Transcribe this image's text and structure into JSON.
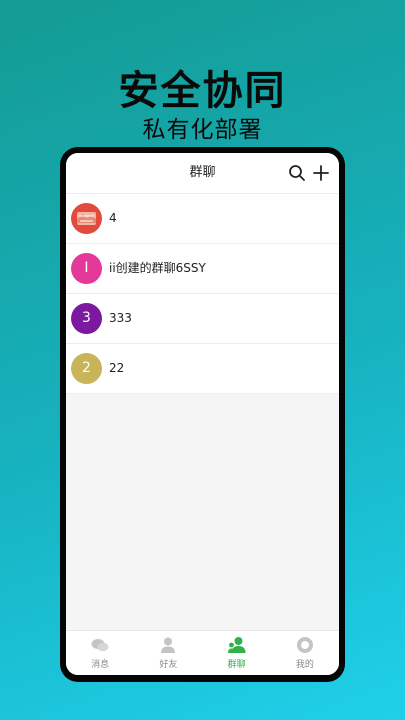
{
  "promo": {
    "headline": "安全协同",
    "subheadline": "私有化部署"
  },
  "header": {
    "title": "群聊",
    "search_icon": "search-icon",
    "add_icon": "plus-icon"
  },
  "groups": [
    {
      "name": "4",
      "avatar_text": "",
      "avatar_color": "#e24b3b",
      "avatar_icon": "group-image-icon"
    },
    {
      "name": "ii创建的群聊6SSY",
      "avatar_text": "I",
      "avatar_color": "#e5399a"
    },
    {
      "name": "333",
      "avatar_text": "3",
      "avatar_color": "#7b1a9e"
    },
    {
      "name": "22",
      "avatar_text": "2",
      "avatar_color": "#c9b45a"
    }
  ],
  "tabs": [
    {
      "label": "消息",
      "icon": "chat-bubbles-icon",
      "active": false
    },
    {
      "label": "好友",
      "icon": "person-icon",
      "active": false
    },
    {
      "label": "群聊",
      "icon": "group-icon",
      "active": true
    },
    {
      "label": "我的",
      "icon": "profile-circle-icon",
      "active": false
    }
  ],
  "colors": {
    "active_tab": "#2fb24a",
    "inactive_tab": "#c4c4c4",
    "background_gradient": [
      "#149b93",
      "#1fd0ea"
    ]
  }
}
